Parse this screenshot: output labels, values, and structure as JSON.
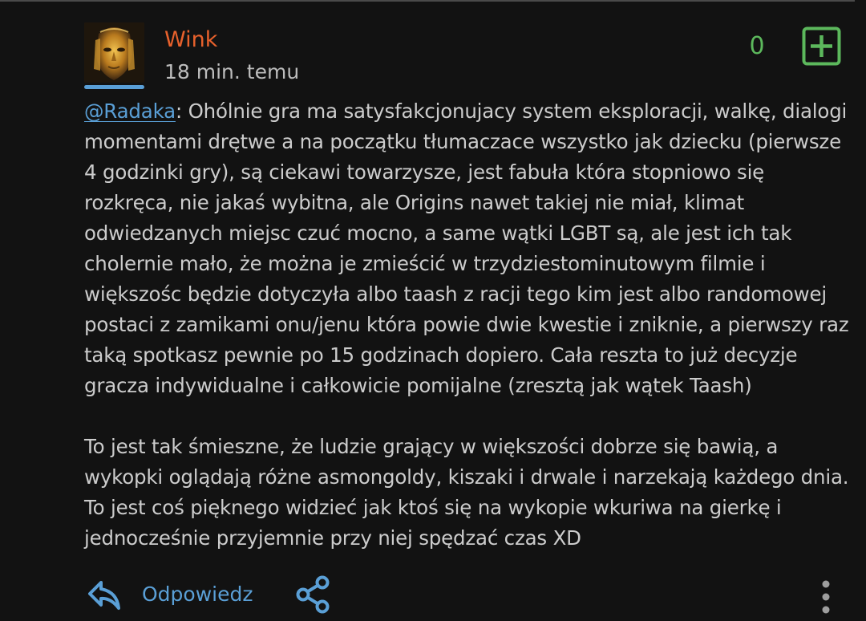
{
  "colors": {
    "background": "#121212",
    "username": "#e8612c",
    "accent_blue": "#5a9fd6",
    "vote_green": "#5cb85c",
    "text": "#cccccc",
    "muted": "#bdbdbd"
  },
  "comment": {
    "username": "Wink",
    "timestamp": "18 min. temu",
    "vote_count": "0",
    "plus_icon": "plus-square-icon",
    "mention": "@Radaka",
    "paragraph1_rest": ": Ohólnie gra ma satysfakcjonujacy system eksploracji, walkę, dialogi momentami drętwe a na początku tłumaczace wszystko jak dziecku (pierwsze 4 godzinki gry), są ciekawi towarzysze, jest fabuła która stopniowo się rozkręca, nie jakaś wybitna, ale Origins nawet takiej nie miał, klimat odwiedzanych miejsc czuć mocno, a same wątki LGBT są, ale jest ich tak cholernie mało, że można je zmieścić w trzydziestominutowym filmie i większośc będzie dotyczyła albo taash z racji tego kim jest albo randomowej postaci z zamikami onu/jenu która powie dwie kwestie i zniknie, a pierwszy raz taką spotkasz pewnie po 15 godzinach dopiero. Cała reszta to już decyzje gracza indywidualne i całkowicie pomijalne (zresztą jak wątek Taash)",
    "paragraph2": "To jest tak śmieszne, że ludzie grający w większości dobrze się bawią, a wykopki oglądają różne asmongoldy, kiszaki i drwale i narzekają każdego dnia. To jest coś pięknego widzieć jak ktoś się na wykopie wkuriwa na gierkę i jednocześnie przyjemnie przy niej spędzać czas XD"
  },
  "footer": {
    "reply_icon": "reply-arrow-icon",
    "reply_label": "Odpowiedz",
    "share_icon": "share-icon",
    "more_icon": "more-vertical-icon"
  }
}
